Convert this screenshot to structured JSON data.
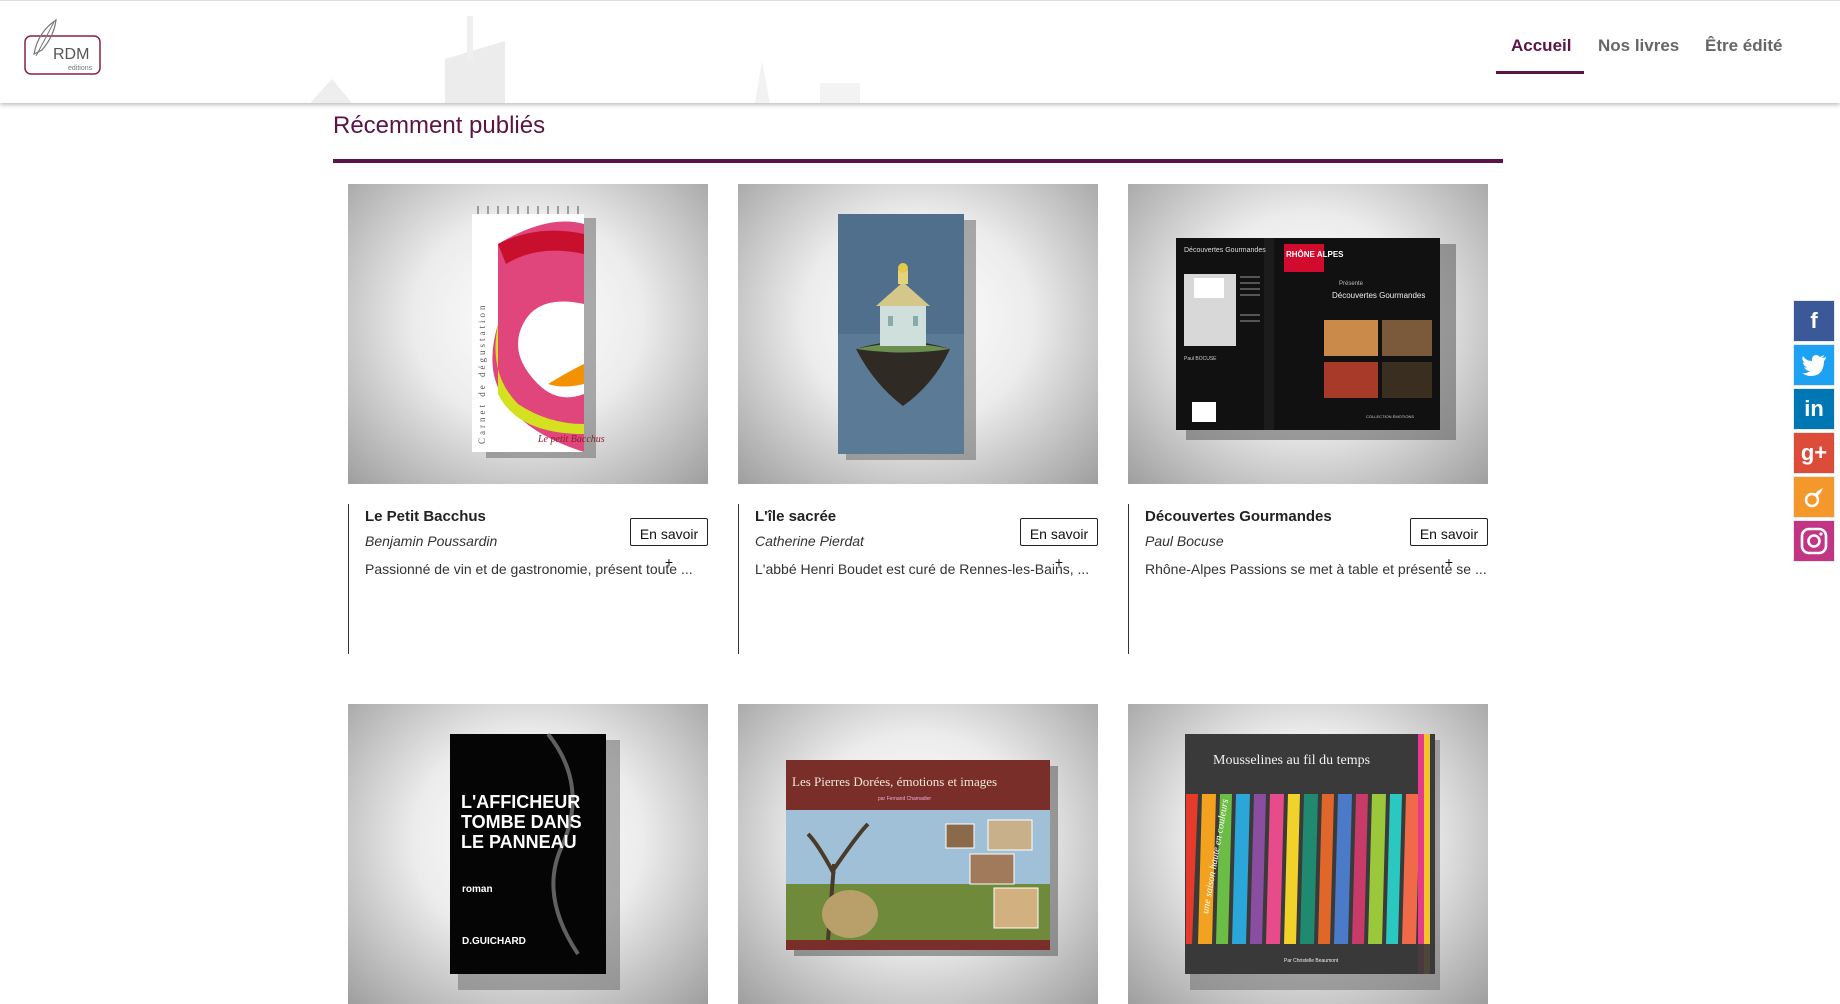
{
  "brand": {
    "logo_main": "RDM",
    "logo_sub": "editions"
  },
  "nav": {
    "items": [
      {
        "label": "Accueil"
      },
      {
        "label": "Nos livres"
      },
      {
        "label": "Être édité"
      }
    ]
  },
  "section": {
    "title": "Récemment publiés"
  },
  "books": [
    {
      "title": "Le Petit Bacchus",
      "author": "Benjamin Poussardin",
      "desc": "Passionné de vin et de gastronomie, présent toute ...",
      "button": "En savoir +",
      "cover_text": "Le petit Bacchus",
      "cover_side": "Carnet de dégustation"
    },
    {
      "title": "L'île sacrée",
      "author": "Catherine Pierdat",
      "desc": "L'abbé Henri Boudet est curé de Rennes-les-Bains, ...",
      "button": "En savoir +"
    },
    {
      "title": "Découvertes Gourmandes",
      "author": "Paul Bocuse",
      "desc": "Rhône-Alpes Passions se met à table et présente se ...",
      "button": "En savoir +",
      "cover_title": "Découvertes Gourmandes",
      "cover_brand": "RHÔNE ALPES",
      "cover_presents": "Présente",
      "cover_author": "Paul BOCUSE",
      "cover_collection": "COLLECTION ÉMOTIONS"
    },
    {
      "cover_title_lines": [
        "L'AFFICHEUR",
        "TOMBE DANS",
        "LE PANNEAU"
      ],
      "cover_genre": "roman",
      "cover_author": "D.GUICHARD"
    },
    {
      "cover_title": "Les Pierres Dorées, émotions et images",
      "cover_subtitle": "par Fernand Chamadier"
    },
    {
      "cover_title": "Mousselines au fil du temps",
      "cover_side": "une saison haute en couleurs",
      "cover_author": "Par Christelle Beaumont"
    }
  ],
  "social": [
    {
      "name": "Facebook",
      "glyph": "f",
      "color": "#3b5998"
    },
    {
      "name": "Twitter",
      "glyph": "t",
      "color": "#1da1f2"
    },
    {
      "name": "LinkedIn",
      "glyph": "in",
      "color": "#0077b5"
    },
    {
      "name": "Google+",
      "glyph": "g+",
      "color": "#dd4b39"
    },
    {
      "name": "Viadeo",
      "glyph": "V",
      "color": "#f4982b"
    },
    {
      "name": "Instagram",
      "glyph": "◎",
      "color": "#c13584"
    }
  ]
}
